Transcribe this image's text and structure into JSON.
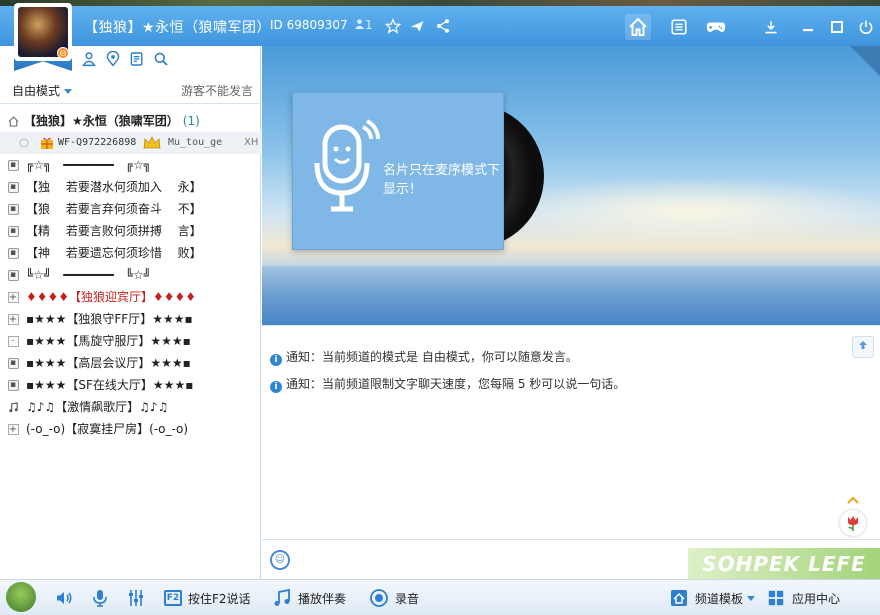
{
  "titlebar": {
    "channel_name": "【独狼】★永恒（狼啸军团）",
    "channel_id": "ID 69809307",
    "online_count": "1",
    "avatar_badge": "⊖"
  },
  "left": {
    "mode_label": "自由模式",
    "guest_note": "游客不能发言",
    "root": {
      "name": "【独狼】★永恒（狼啸军团）",
      "count": "(1)"
    },
    "user": {
      "id": "WF-Q972226898",
      "nick": "Mu_tou_ge",
      "tag": "XH"
    },
    "channels": [
      {
        "icon": "lock",
        "label": "╔☆╗　━━━━━━━　╔☆╗"
      },
      {
        "icon": "lock",
        "label": "【独　 若要潜水何须加入　 永】"
      },
      {
        "icon": "lock",
        "label": "【狼　 若要言弃何须奋斗　 不】"
      },
      {
        "icon": "lock",
        "label": "【精　 若要言败何须拼搏　 言】"
      },
      {
        "icon": "lock",
        "label": "【神　 若要遗忘何须珍惜　 败】"
      },
      {
        "icon": "lock",
        "label": "╚☆╝　━━━━━━━　╚☆╝"
      },
      {
        "icon": "plus",
        "label": "♦♦♦♦【独狼迎宾厅】♦♦♦♦",
        "red": true
      },
      {
        "icon": "plus",
        "label": "▪★★★【独狼守FF厅】★★★▪"
      },
      {
        "icon": "dot",
        "label": "▪★★★【馬旋守服厅】★★★▪"
      },
      {
        "icon": "lock",
        "label": "▪★★★【高层会议厅】★★★▪"
      },
      {
        "icon": "lock",
        "label": "▪★★★【SF在线大厅】★★★▪"
      },
      {
        "icon": "music",
        "label": "♫♪♫【激情飙歌厅】♫♪♫"
      },
      {
        "icon": "plus",
        "label": "(-o_-o)【寂寞挂尸房】(-o_-o)"
      }
    ]
  },
  "banner": {
    "card_message": "名片只在麦序模式下显示！"
  },
  "chat": {
    "notices": [
      "通知：当前频道的模式是 自由模式，你可以随意发言。",
      "通知：当前频道限制文字聊天速度，您每隔 5 秒可以说一句话。"
    ]
  },
  "input": {
    "watermark": "SOHPEK LEFE"
  },
  "bottombar": {
    "f2_key": "F2",
    "ptt_label": "按住F2说话",
    "music_label": "播放伴奏",
    "record_label": "录音",
    "template_label": "频道模板",
    "app_center_label": "应用中心"
  },
  "colors": {
    "titlebar": "#4aa0e6",
    "accent": "#2f7fd0",
    "red_channel": "#c81e1e"
  }
}
